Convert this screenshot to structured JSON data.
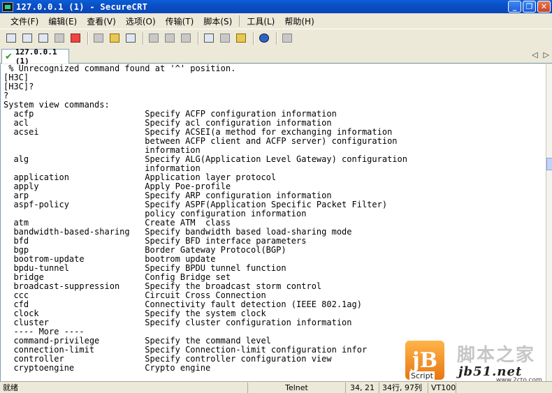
{
  "window": {
    "title": "127.0.0.1 (1) - SecureCRT"
  },
  "menu": [
    "文件(F)",
    "编辑(E)",
    "查看(V)",
    "选项(O)",
    "传输(T)",
    "脚本(S)",
    "工具(L)",
    "帮助(H)"
  ],
  "tab": {
    "label": "127.0.0.1 (1)"
  },
  "terminal": {
    "lines": [
      " % Unrecognized command found at '^' position.",
      "[H3C]",
      "[H3C]?",
      "?",
      "System view commands:",
      "  acfp                      Specify ACFP configuration information",
      "  acl                       Specify acl configuration information",
      "  acsei                     Specify ACSEI(a method for exchanging information",
      "                            between ACFP client and ACFP server) configuration",
      "                            information",
      "  alg                       Specify ALG(Application Level Gateway) configuration",
      "                            information",
      "  application               Application layer protocol",
      "  apply                     Apply Poe-profile",
      "  arp                       Specify ARP configuration information",
      "  aspf-policy               Specify ASPF(Application Specific Packet Filter)",
      "                            policy configuration information",
      "  atm                       Create ATM  class",
      "  bandwidth-based-sharing   Specify bandwidth based load-sharing mode",
      "  bfd                       Specify BFD interface parameters",
      "  bgp                       Border Gateway Protocol(BGP)",
      "  bootrom-update            bootrom update",
      "  bpdu-tunnel               Specify BPDU tunnel function",
      "  bridge                    Config Bridge set",
      "  broadcast-suppression     Specify the broadcast storm control",
      "  ccc                       Circuit Cross Connection",
      "  cfd                       Connectivity fault detection (IEEE 802.1ag)",
      "  clock                     Specify the system clock",
      "  cluster                   Specify cluster configuration information",
      "  ---- More ----",
      "  command-privilege         Specify the command level",
      "  connection-limit          Specify Connection-limit configuration infor",
      "  controller                Specify controller configuration view",
      "  cryptoengine              Crypto engine"
    ]
  },
  "watermark": {
    "logo": "jB",
    "script_label": "Script",
    "cn_text": "脚本之家",
    "url": "jb51.net",
    "sub": "www.2cto.com"
  },
  "status": {
    "ready": "就绪",
    "protocol": "Telnet",
    "position": "34, 21",
    "rows": "34行, 97列",
    "term": "VT100"
  }
}
